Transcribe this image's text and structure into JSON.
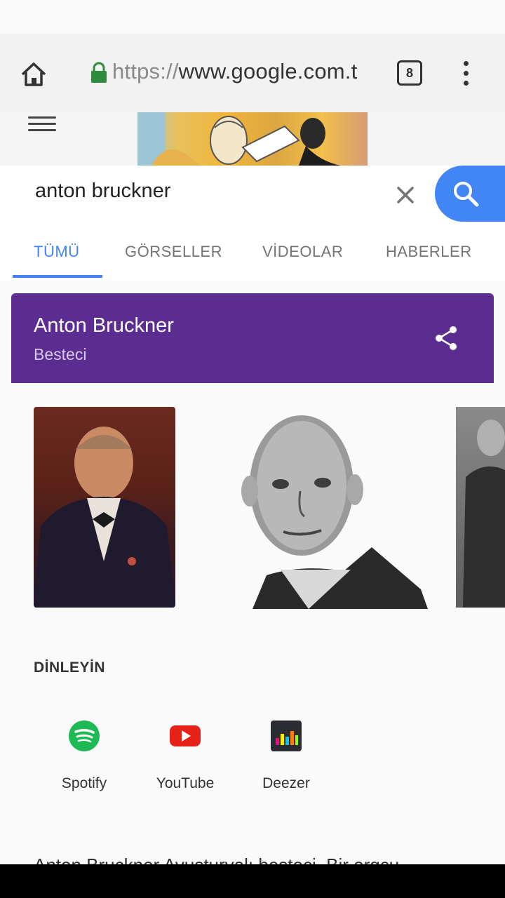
{
  "browser": {
    "url_scheme": "https://",
    "url_host": "www.google.com.tr",
    "tab_count": "8",
    "home_icon": "home-icon",
    "lock_icon": "lock-icon",
    "menu_icon": "overflow-menu-icon"
  },
  "search": {
    "query": "anton bruckner",
    "clear_icon": "close-icon",
    "search_icon": "search-icon"
  },
  "tabs": [
    {
      "label": "TÜMÜ",
      "active": true
    },
    {
      "label": "GÖRSELLER",
      "active": false
    },
    {
      "label": "VİDEOLAR",
      "active": false
    },
    {
      "label": "HABERLER",
      "active": false
    }
  ],
  "knowledge_panel": {
    "title": "Anton Bruckner",
    "subtitle": "Besteci",
    "header_color": "#5c2d91",
    "share_icon": "share-icon"
  },
  "listen": {
    "title": "DİNLEYİN",
    "apps": [
      {
        "label": "Spotify",
        "icon": "spotify-icon",
        "color": "#1db954"
      },
      {
        "label": "YouTube",
        "icon": "youtube-icon",
        "color": "#e62117"
      },
      {
        "label": "Deezer",
        "icon": "deezer-icon",
        "color": "#2b2b33"
      }
    ]
  },
  "snippet": {
    "text": "Anton Bruckner Avusturyalı besteci. Bir orgcu"
  }
}
